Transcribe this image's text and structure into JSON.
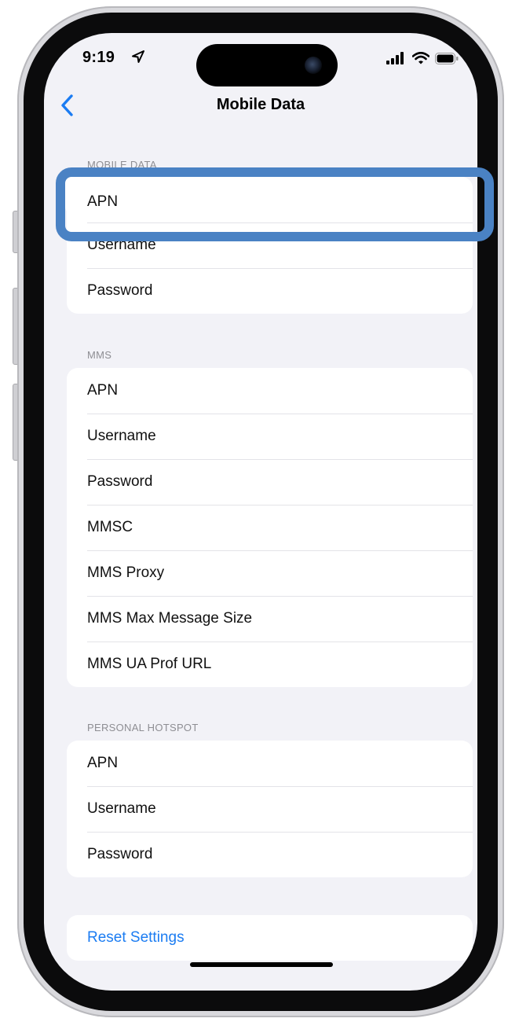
{
  "status_bar": {
    "time": "9:19",
    "icons": [
      "location-arrow-icon",
      "cellular-signal-icon",
      "wifi-icon",
      "battery-icon"
    ]
  },
  "nav": {
    "back_icon": "chevron-left-icon",
    "title": "Mobile Data"
  },
  "sections": {
    "mobile_data": {
      "header": "MOBILE DATA",
      "rows": [
        "APN",
        "Username",
        "Password"
      ]
    },
    "mms": {
      "header": "MMS",
      "rows": [
        "APN",
        "Username",
        "Password",
        "MMSC",
        "MMS Proxy",
        "MMS Max Message Size",
        "MMS UA Prof URL"
      ]
    },
    "personal_hotspot": {
      "header": "PERSONAL HOTSPOT",
      "rows": [
        "APN",
        "Username",
        "Password"
      ]
    },
    "reset": {
      "label": "Reset Settings"
    }
  },
  "colors": {
    "accent": "#1b7cf2",
    "highlight": "#4a82c4",
    "background": "#f2f2f7"
  }
}
